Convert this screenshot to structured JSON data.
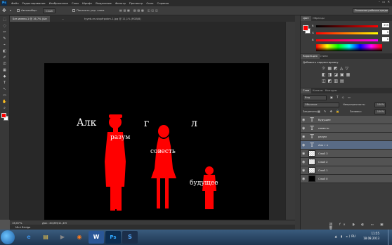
{
  "app": {
    "logo": "Ps"
  },
  "menubar": {
    "items": [
      "Файл",
      "Редактирование",
      "Изображение",
      "Слои",
      "Шрифт",
      "Выделение",
      "Фильтр",
      "Просмотр",
      "Окно",
      "Справка"
    ],
    "controls": [
      "–",
      "▭",
      "✕"
    ]
  },
  "options": {
    "autoselect_label": "Автовыбор:",
    "autoselect_value": "Слой",
    "transform_label": "Показать упр. элем.",
    "workspace": "Основная рабочая среда"
  },
  "tools": [
    "⬚",
    "◌",
    "✂",
    "✎",
    "⌁",
    "◧",
    "✐",
    "⎚",
    "▦",
    "◆",
    "T",
    "↖",
    "▭",
    "✋",
    "⌕"
  ],
  "tabs": [
    {
      "label": "Без имени-1 @ 16,7% (Ale",
      "active": true
    },
    {
      "label": "...",
      "active": false
    },
    {
      "label": "tyyeb-en-stopfrpxbm-1.jpg @ 11,1% (RGB/8)",
      "active": false
    }
  ],
  "canvas": {
    "letters": [
      "Алк",
      "г",
      "л"
    ],
    "words": [
      "разум",
      "совесть",
      "будущее"
    ],
    "silhouette_color": "#ff0000",
    "background": "#000000"
  },
  "status": {
    "zoom": "16,67%",
    "doc": "Док: 40,8M/11,4M",
    "minibridge": "Mini Bridge"
  },
  "color_panel": {
    "tabs": [
      "Цвет",
      "Образцы"
    ],
    "channels": [
      {
        "label": "R",
        "value": "255"
      },
      {
        "label": "G",
        "value": "0"
      },
      {
        "label": "B",
        "value": "0"
      }
    ],
    "fg": "#ff0000",
    "bg": "#ffffff"
  },
  "adjust_panel": {
    "tabs": [
      "Коррекция",
      "Стили"
    ],
    "title": "Добавить корректировку"
  },
  "layers_panel": {
    "tabs": [
      "Слои",
      "Каналы",
      "Контуры"
    ],
    "kind": "Вид",
    "blend": "Обычные",
    "opacity_label": "Непрозрачность:",
    "opacity": "100%",
    "lock_label": "Закрепить:",
    "fill_label": "Заливка:",
    "fill": "100%",
    "layers": [
      {
        "name": "будущее",
        "kind": "text",
        "selected": false
      },
      {
        "name": "совесть",
        "kind": "text",
        "selected": false
      },
      {
        "name": "разум",
        "kind": "text",
        "selected": false
      },
      {
        "name": "Алк       г       л",
        "kind": "text",
        "selected": true
      },
      {
        "name": "Слой 3",
        "kind": "checker",
        "selected": false
      },
      {
        "name": "Слой 2",
        "kind": "checker",
        "selected": false
      },
      {
        "name": "Слой 1",
        "kind": "checker",
        "selected": false
      },
      {
        "name": "Слой 0",
        "kind": "black",
        "selected": false
      }
    ]
  },
  "taskbar": {
    "lang": "RU",
    "time": "11:55",
    "date": "18.08.2013"
  }
}
